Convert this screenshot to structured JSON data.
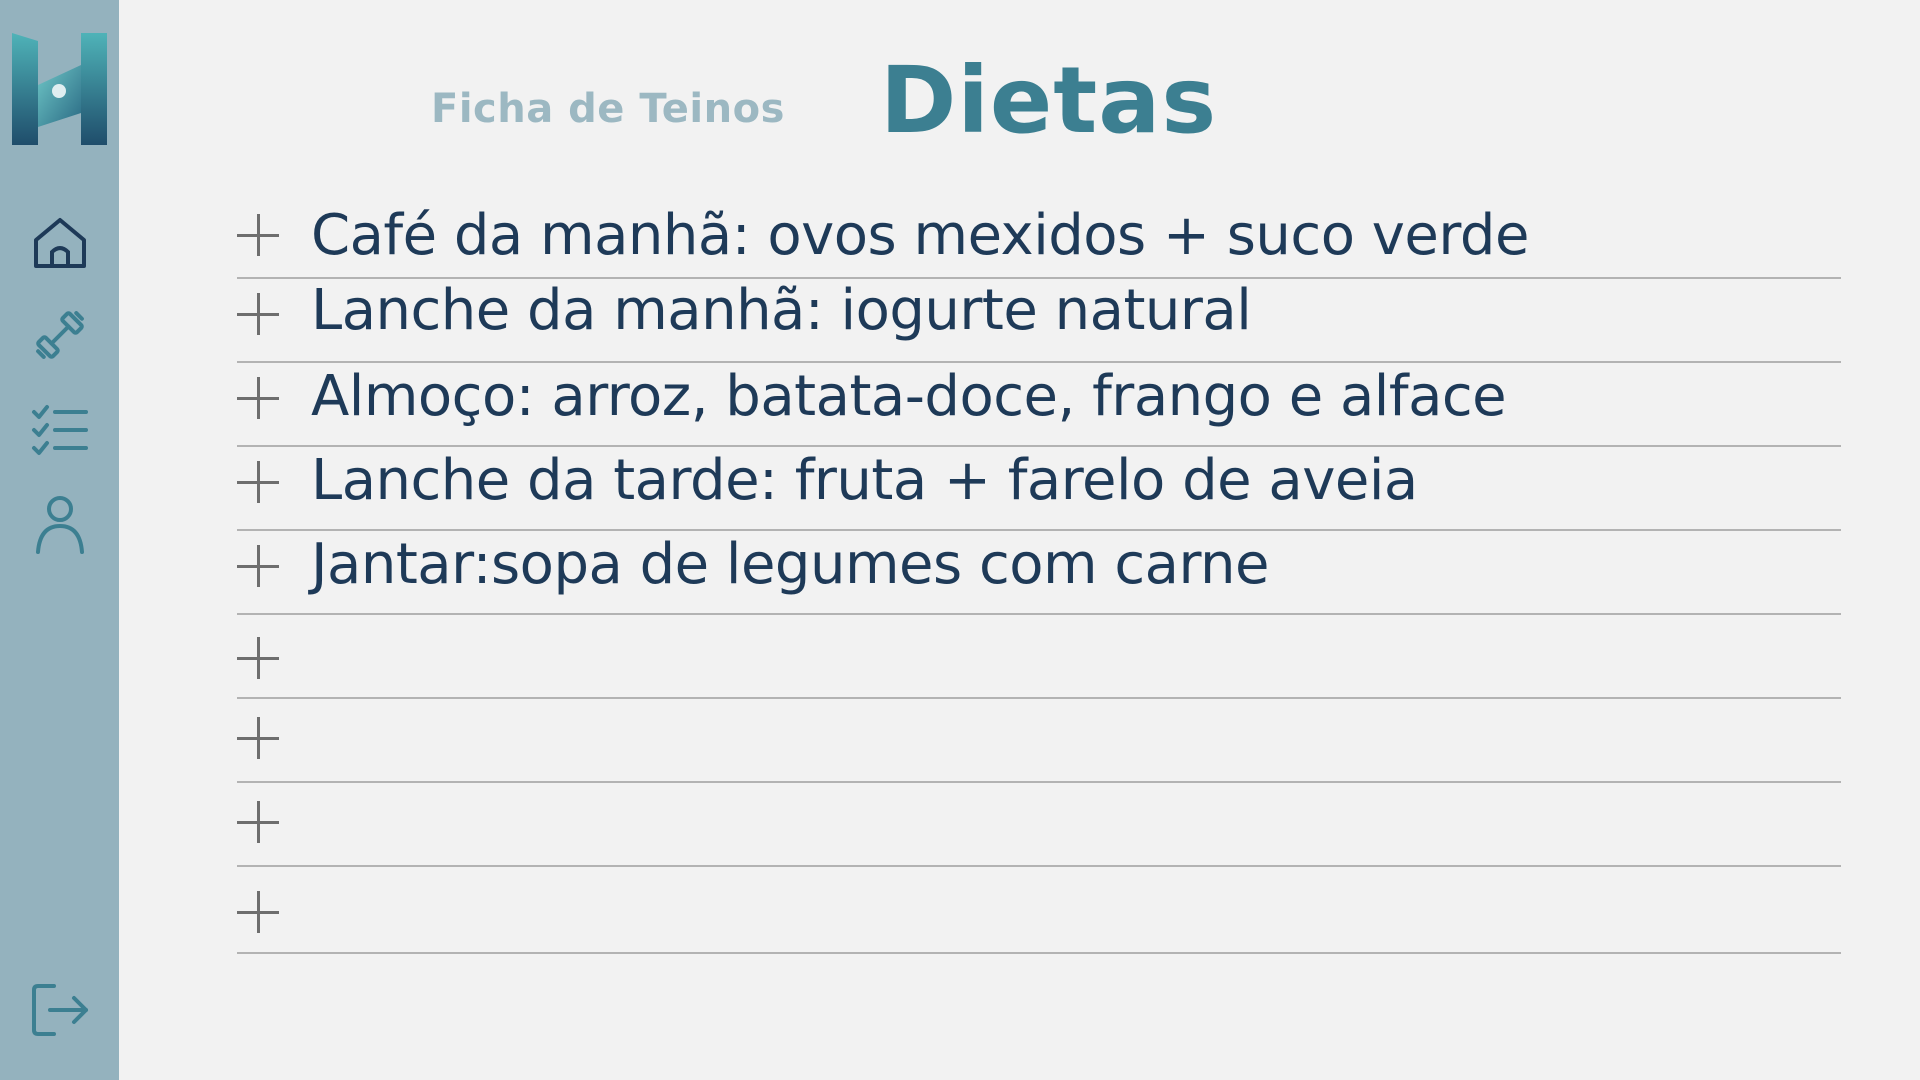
{
  "header": {
    "trainings_tab": "Ficha de Teinos",
    "title": "Dietas"
  },
  "sidebar": {
    "items": [
      {
        "icon": "home-icon"
      },
      {
        "icon": "dumbbell-icon"
      },
      {
        "icon": "checklist-icon"
      },
      {
        "icon": "user-icon"
      }
    ],
    "logout_icon": "logout-icon"
  },
  "meals": [
    {
      "text": "Café da manhã: ovos mexidos + suco verde"
    },
    {
      "text": "Lanche da manhã: iogurte natural"
    },
    {
      "text": "Almoço:  arroz, batata-doce, frango  e alface"
    },
    {
      "text": "Lanche da tarde: fruta + farelo de aveia"
    },
    {
      "text": "Jantar:sopa de legumes com carne"
    },
    {
      "text": ""
    },
    {
      "text": ""
    },
    {
      "text": ""
    },
    {
      "text": ""
    }
  ],
  "colors": {
    "sidebar": "#94b2be",
    "title": "#3c7f91",
    "tab": "#9cb8c2",
    "text": "#1e3a58",
    "background": "#f2f2f2"
  }
}
